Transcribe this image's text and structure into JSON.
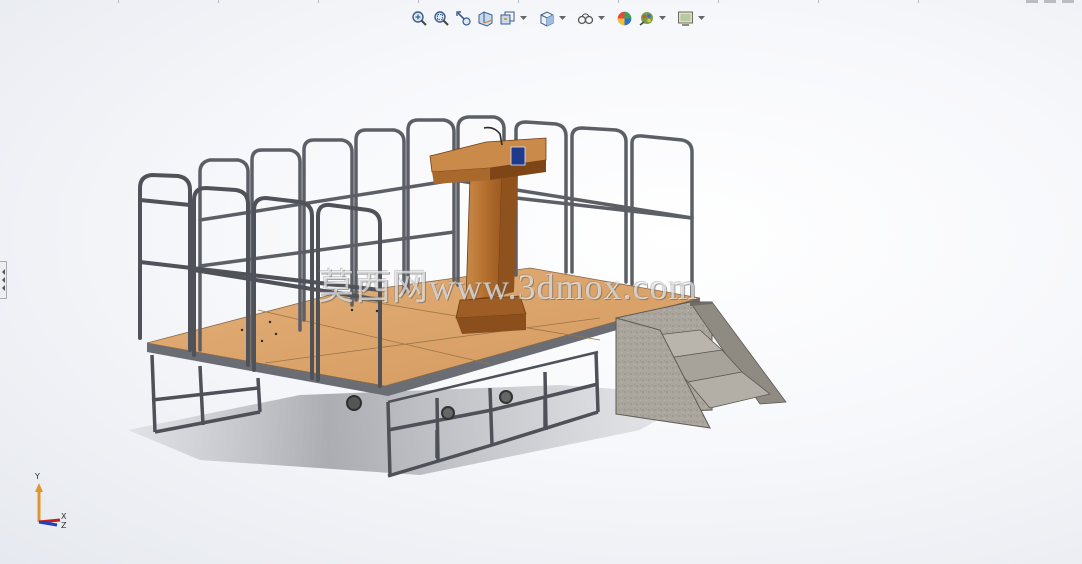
{
  "viewport": {
    "background": "gradient-white-to-light-gray",
    "model": "portable stage platform with guard rails, podium and side stairs"
  },
  "heads_up_toolbar": {
    "items": [
      {
        "name": "zoom-to-fit-icon"
      },
      {
        "name": "zoom-to-area-icon"
      },
      {
        "name": "previous-view-icon"
      },
      {
        "name": "section-view-icon"
      },
      {
        "name": "dynamic-annotation-views-icon",
        "dropdown": true
      },
      {
        "name": "view-orientation-icon",
        "dropdown": true
      },
      {
        "name": "display-style-icon",
        "dropdown": true
      },
      {
        "name": "hide-show-items-icon",
        "dropdown": false
      },
      {
        "name": "edit-appearance-icon",
        "dropdown": true
      },
      {
        "name": "apply-scene-icon",
        "dropdown": true
      },
      {
        "name": "view-settings-icon",
        "dropdown": true
      }
    ]
  },
  "watermark": {
    "text": "莫西网www.3dmox.com"
  },
  "triad": {
    "y_label": "Y",
    "x_label": "X",
    "z_label": "Z"
  },
  "colors": {
    "frame_metal": "#5c5f66",
    "deck_wood": "#d9a46a",
    "podium_wood": "#b06a2c",
    "stair_stone": "#a8a39b",
    "triad_y": "#e0962a",
    "triad_x": "#c02020",
    "triad_z": "#2040c0"
  }
}
